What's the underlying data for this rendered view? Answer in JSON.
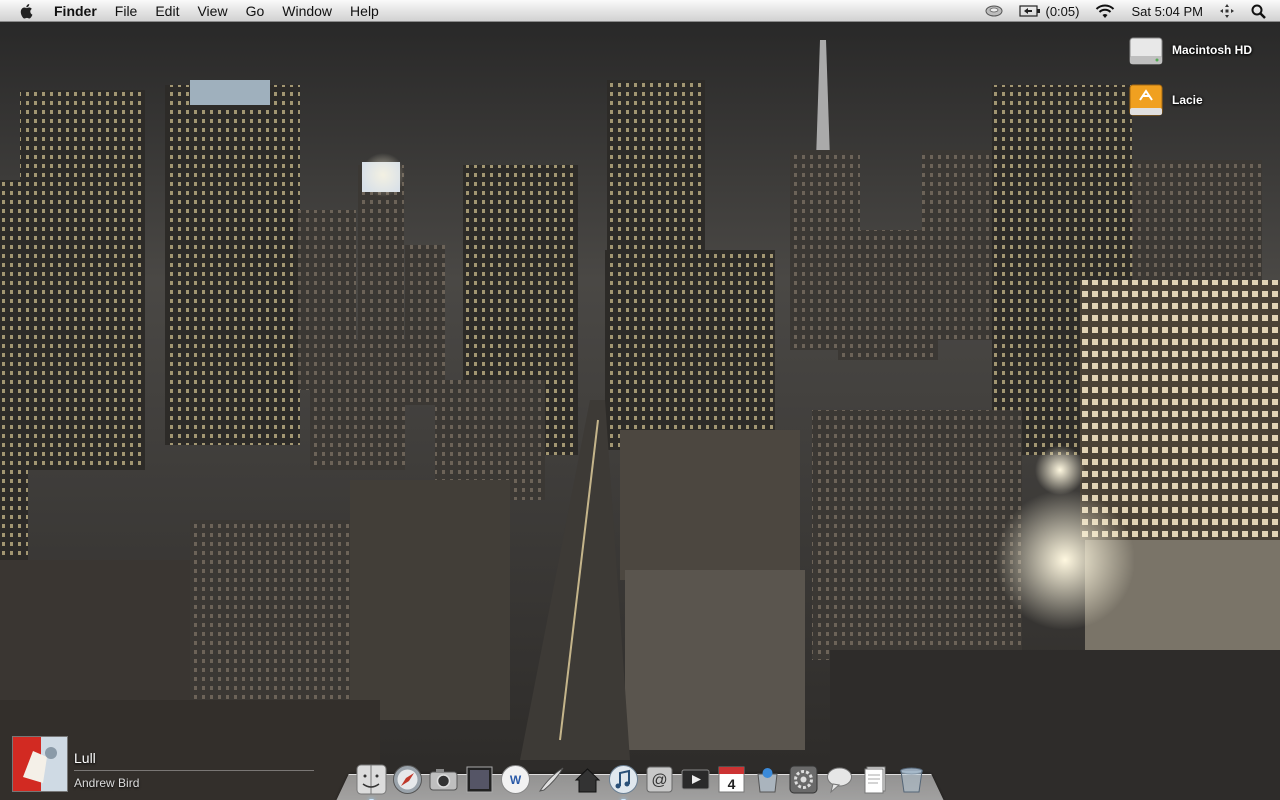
{
  "menubar": {
    "app_name": "Finder",
    "menus": [
      "File",
      "Edit",
      "View",
      "Go",
      "Window",
      "Help"
    ],
    "battery_time": "(0:05)",
    "clock": "Sat 5:04 PM"
  },
  "desktop_icons": [
    {
      "label": "Macintosh HD",
      "icon": "hard-drive-icon"
    },
    {
      "label": "Lacie",
      "icon": "firewire-drive-icon"
    }
  ],
  "now_playing": {
    "title": "Lull",
    "artist": "Andrew Bird"
  },
  "dock": {
    "apps": [
      {
        "name": "finder",
        "icon": "finder-icon",
        "running": true
      },
      {
        "name": "safari",
        "icon": "safari-compass-icon",
        "running": false
      },
      {
        "name": "camera",
        "icon": "camera-icon",
        "running": false
      },
      {
        "name": "photo",
        "icon": "photo-frame-icon",
        "running": false
      },
      {
        "name": "word",
        "icon": "word-document-icon",
        "running": false
      },
      {
        "name": "script-editor",
        "icon": "quill-icon",
        "running": false
      },
      {
        "name": "automator",
        "icon": "house-icon",
        "running": false
      },
      {
        "name": "itunes",
        "icon": "music-note-icon",
        "running": true
      },
      {
        "name": "mail",
        "icon": "at-sign-icon",
        "running": false
      },
      {
        "name": "dvd-player",
        "icon": "play-icon",
        "running": false
      },
      {
        "name": "ical",
        "icon": "calendar-icon",
        "running": false
      },
      {
        "name": "applications-stack",
        "icon": "stack-icon",
        "running": false
      },
      {
        "name": "system-preferences",
        "icon": "gear-icon",
        "running": false
      },
      {
        "name": "ichat",
        "icon": "chat-icon",
        "running": false
      },
      {
        "name": "documents-stack",
        "icon": "documents-icon",
        "running": false
      },
      {
        "name": "trash",
        "icon": "trash-icon",
        "running": false
      }
    ],
    "calendar_day": "4"
  },
  "colors": {
    "menubar_top": "#fafafa",
    "menubar_bottom": "#d2d2d2",
    "lacie_orange": "#f0a020"
  }
}
